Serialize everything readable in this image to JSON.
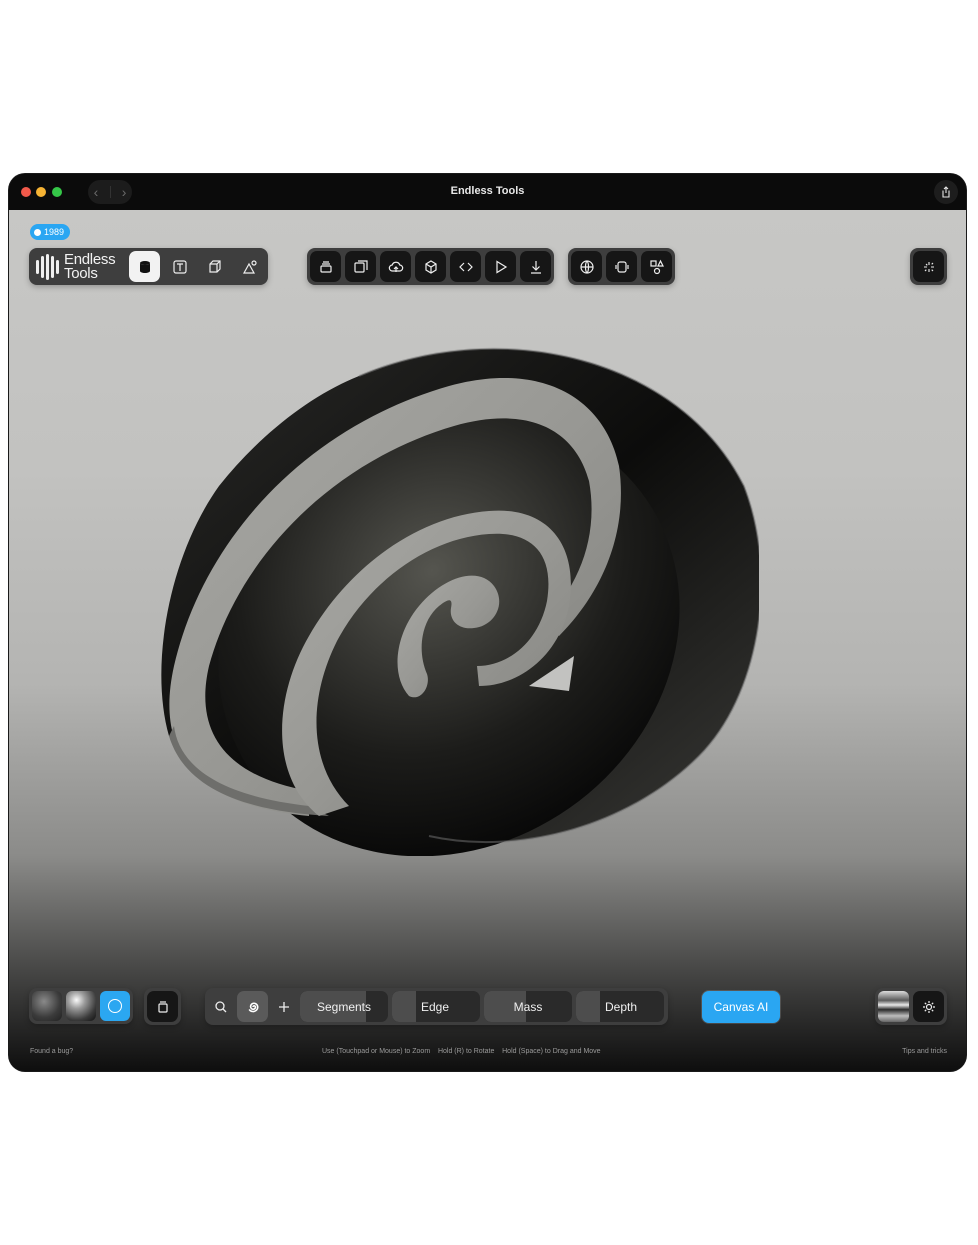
{
  "window": {
    "title": "Endless Tools"
  },
  "version_badge": "1989",
  "brand": {
    "line1": "Endless",
    "line2": "Tools"
  },
  "mode_tools": [
    {
      "icon": "cylinder-icon",
      "active": true
    },
    {
      "icon": "text-icon",
      "active": false
    },
    {
      "icon": "cube-icon",
      "active": false
    },
    {
      "icon": "shapes-icon",
      "active": false
    }
  ],
  "toolbar_icons": [
    "layers-icon",
    "export-frame-icon",
    "cloud-upload-icon",
    "box-3d-icon",
    "code-icon",
    "play-icon",
    "download-icon"
  ],
  "view_icons": [
    "globe-icon",
    "device-icon",
    "shapes-library-icon"
  ],
  "sparkle_icon": "sparkle-icon",
  "materials": [
    "matte-material-icon",
    "glossy-material-icon",
    "custom-material-icon"
  ],
  "params": {
    "segments": {
      "label": "Segments",
      "value": 0.75
    },
    "edge": {
      "label": "Edge",
      "value": 0.27
    },
    "mass": {
      "label": "Mass",
      "value": 0.48
    },
    "depth": {
      "label": "Depth",
      "value": 0.27
    }
  },
  "canvas_ai": "Canvas AI",
  "footer": {
    "left": "Found a bug?",
    "center": "Use (Touchpad or Mouse) to Zoom    Hold (R) to Rotate    Hold (Space) to Drag and Move",
    "right": "Tips and tricks"
  },
  "colors": {
    "accent": "#2aa6f2",
    "toolbar": "#161616",
    "panel": "#3e3e3e"
  }
}
